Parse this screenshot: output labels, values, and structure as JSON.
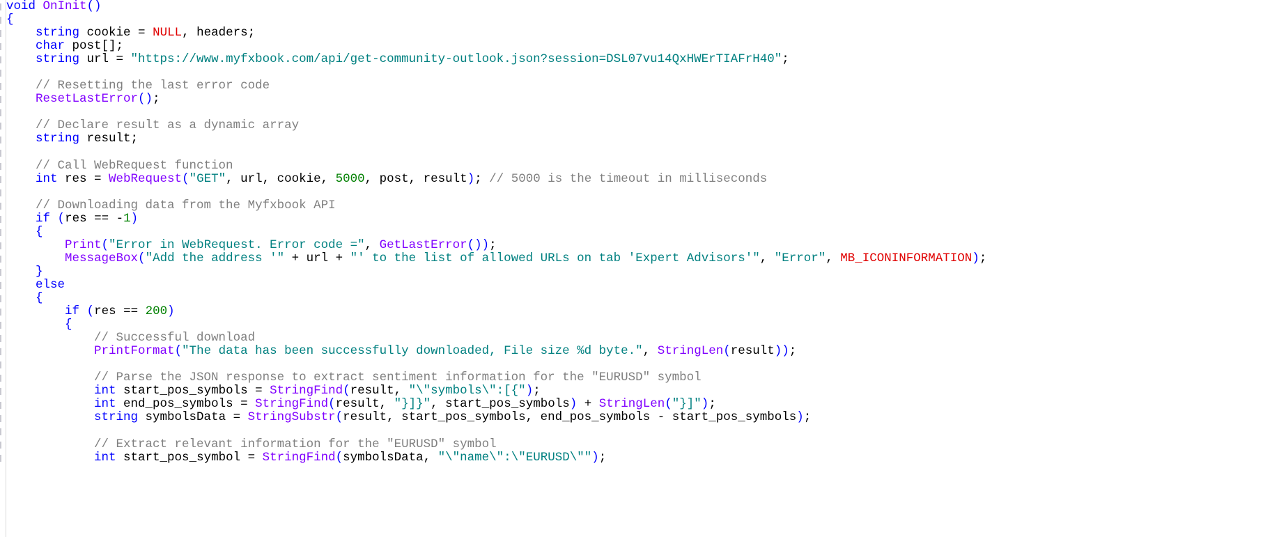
{
  "editor": {
    "colors": {
      "keyword": "#0000ff",
      "function": "#8000ff",
      "string": "#008080",
      "comment": "#808080",
      "number": "#008000",
      "constant": "#e00000",
      "plain": "#000000",
      "bracket": "#0000ff"
    },
    "lines": [
      [
        {
          "t": "kw",
          "v": "void"
        },
        {
          "t": "pl",
          "v": " "
        },
        {
          "t": "fn",
          "v": "OnInit"
        },
        {
          "t": "br",
          "v": "()"
        }
      ],
      [
        {
          "t": "br",
          "v": "{"
        }
      ],
      [
        {
          "t": "pl",
          "v": "    "
        },
        {
          "t": "kw",
          "v": "string"
        },
        {
          "t": "pl",
          "v": " cookie = "
        },
        {
          "t": "const",
          "v": "NULL"
        },
        {
          "t": "pl",
          "v": ", headers;"
        }
      ],
      [
        {
          "t": "pl",
          "v": "    "
        },
        {
          "t": "kw",
          "v": "char"
        },
        {
          "t": "pl",
          "v": " post[];"
        }
      ],
      [
        {
          "t": "pl",
          "v": "    "
        },
        {
          "t": "kw",
          "v": "string"
        },
        {
          "t": "pl",
          "v": " url = "
        },
        {
          "t": "str",
          "v": "\"https://www.myfxbook.com/api/get-community-outlook.json?session=DSL07vu14QxHWErTIAFrH40\""
        },
        {
          "t": "pl",
          "v": ";"
        }
      ],
      [],
      [
        {
          "t": "pl",
          "v": "    "
        },
        {
          "t": "cm",
          "v": "// Resetting the last error code"
        }
      ],
      [
        {
          "t": "pl",
          "v": "    "
        },
        {
          "t": "fn",
          "v": "ResetLastError"
        },
        {
          "t": "br",
          "v": "()"
        },
        {
          "t": "pl",
          "v": ";"
        }
      ],
      [],
      [
        {
          "t": "pl",
          "v": "    "
        },
        {
          "t": "cm",
          "v": "// Declare result as a dynamic array"
        }
      ],
      [
        {
          "t": "pl",
          "v": "    "
        },
        {
          "t": "kw",
          "v": "string"
        },
        {
          "t": "pl",
          "v": " result;"
        }
      ],
      [],
      [
        {
          "t": "pl",
          "v": "    "
        },
        {
          "t": "cm",
          "v": "// Call WebRequest function"
        }
      ],
      [
        {
          "t": "pl",
          "v": "    "
        },
        {
          "t": "kw",
          "v": "int"
        },
        {
          "t": "pl",
          "v": " res = "
        },
        {
          "t": "fn",
          "v": "WebRequest"
        },
        {
          "t": "br",
          "v": "("
        },
        {
          "t": "str",
          "v": "\"GET\""
        },
        {
          "t": "pl",
          "v": ", url, cookie, "
        },
        {
          "t": "num",
          "v": "5000"
        },
        {
          "t": "pl",
          "v": ", post, result"
        },
        {
          "t": "br",
          "v": ")"
        },
        {
          "t": "pl",
          "v": "; "
        },
        {
          "t": "cm",
          "v": "// 5000 is the timeout in milliseconds"
        }
      ],
      [],
      [
        {
          "t": "pl",
          "v": "    "
        },
        {
          "t": "cm",
          "v": "// Downloading data from the Myfxbook API"
        }
      ],
      [
        {
          "t": "pl",
          "v": "    "
        },
        {
          "t": "kw",
          "v": "if"
        },
        {
          "t": "pl",
          "v": " "
        },
        {
          "t": "br",
          "v": "("
        },
        {
          "t": "pl",
          "v": "res == -"
        },
        {
          "t": "num",
          "v": "1"
        },
        {
          "t": "br",
          "v": ")"
        }
      ],
      [
        {
          "t": "pl",
          "v": "    "
        },
        {
          "t": "br",
          "v": "{"
        }
      ],
      [
        {
          "t": "pl",
          "v": "        "
        },
        {
          "t": "fn",
          "v": "Print"
        },
        {
          "t": "br",
          "v": "("
        },
        {
          "t": "str",
          "v": "\"Error in WebRequest. Error code =\""
        },
        {
          "t": "pl",
          "v": ", "
        },
        {
          "t": "fn",
          "v": "GetLastError"
        },
        {
          "t": "br",
          "v": "())"
        },
        {
          "t": "pl",
          "v": ";"
        }
      ],
      [
        {
          "t": "pl",
          "v": "        "
        },
        {
          "t": "fn",
          "v": "MessageBox"
        },
        {
          "t": "br",
          "v": "("
        },
        {
          "t": "str",
          "v": "\"Add the address '\""
        },
        {
          "t": "pl",
          "v": " + url + "
        },
        {
          "t": "str",
          "v": "\"' to the list of allowed URLs on tab 'Expert Advisors'\""
        },
        {
          "t": "pl",
          "v": ", "
        },
        {
          "t": "str",
          "v": "\"Error\""
        },
        {
          "t": "pl",
          "v": ", "
        },
        {
          "t": "const",
          "v": "MB_ICONINFORMATION"
        },
        {
          "t": "br",
          "v": ")"
        },
        {
          "t": "pl",
          "v": ";"
        }
      ],
      [
        {
          "t": "pl",
          "v": "    "
        },
        {
          "t": "br",
          "v": "}"
        }
      ],
      [
        {
          "t": "pl",
          "v": "    "
        },
        {
          "t": "kw",
          "v": "else"
        }
      ],
      [
        {
          "t": "pl",
          "v": "    "
        },
        {
          "t": "br",
          "v": "{"
        }
      ],
      [
        {
          "t": "pl",
          "v": "        "
        },
        {
          "t": "kw",
          "v": "if"
        },
        {
          "t": "pl",
          "v": " "
        },
        {
          "t": "br",
          "v": "("
        },
        {
          "t": "pl",
          "v": "res == "
        },
        {
          "t": "num",
          "v": "200"
        },
        {
          "t": "br",
          "v": ")"
        }
      ],
      [
        {
          "t": "pl",
          "v": "        "
        },
        {
          "t": "br",
          "v": "{"
        }
      ],
      [
        {
          "t": "pl",
          "v": "            "
        },
        {
          "t": "cm",
          "v": "// Successful download"
        }
      ],
      [
        {
          "t": "pl",
          "v": "            "
        },
        {
          "t": "fn",
          "v": "PrintFormat"
        },
        {
          "t": "br",
          "v": "("
        },
        {
          "t": "str",
          "v": "\"The data has been successfully downloaded, File size %d byte.\""
        },
        {
          "t": "pl",
          "v": ", "
        },
        {
          "t": "fn",
          "v": "StringLen"
        },
        {
          "t": "br",
          "v": "("
        },
        {
          "t": "pl",
          "v": "result"
        },
        {
          "t": "br",
          "v": "))"
        },
        {
          "t": "pl",
          "v": ";"
        }
      ],
      [],
      [
        {
          "t": "pl",
          "v": "            "
        },
        {
          "t": "cm",
          "v": "// Parse the JSON response to extract sentiment information for the \"EURUSD\" symbol"
        }
      ],
      [
        {
          "t": "pl",
          "v": "            "
        },
        {
          "t": "kw",
          "v": "int"
        },
        {
          "t": "pl",
          "v": " start_pos_symbols = "
        },
        {
          "t": "fn",
          "v": "StringFind"
        },
        {
          "t": "br",
          "v": "("
        },
        {
          "t": "pl",
          "v": "result, "
        },
        {
          "t": "str",
          "v": "\"\\\"symbols\\\":[{\""
        },
        {
          "t": "br",
          "v": ")"
        },
        {
          "t": "pl",
          "v": ";"
        }
      ],
      [
        {
          "t": "pl",
          "v": "            "
        },
        {
          "t": "kw",
          "v": "int"
        },
        {
          "t": "pl",
          "v": " end_pos_symbols = "
        },
        {
          "t": "fn",
          "v": "StringFind"
        },
        {
          "t": "br",
          "v": "("
        },
        {
          "t": "pl",
          "v": "result, "
        },
        {
          "t": "str",
          "v": "\"}]}\""
        },
        {
          "t": "pl",
          "v": ", start_pos_symbols"
        },
        {
          "t": "br",
          "v": ")"
        },
        {
          "t": "pl",
          "v": " + "
        },
        {
          "t": "fn",
          "v": "StringLen"
        },
        {
          "t": "br",
          "v": "("
        },
        {
          "t": "str",
          "v": "\"}]\""
        },
        {
          "t": "br",
          "v": ")"
        },
        {
          "t": "pl",
          "v": ";"
        }
      ],
      [
        {
          "t": "pl",
          "v": "            "
        },
        {
          "t": "kw",
          "v": "string"
        },
        {
          "t": "pl",
          "v": " symbolsData = "
        },
        {
          "t": "fn",
          "v": "StringSubstr"
        },
        {
          "t": "br",
          "v": "("
        },
        {
          "t": "pl",
          "v": "result, start_pos_symbols, end_pos_symbols - start_pos_symbols"
        },
        {
          "t": "br",
          "v": ")"
        },
        {
          "t": "pl",
          "v": ";"
        }
      ],
      [],
      [
        {
          "t": "pl",
          "v": "            "
        },
        {
          "t": "cm",
          "v": "// Extract relevant information for the \"EURUSD\" symbol"
        }
      ],
      [
        {
          "t": "pl",
          "v": "            "
        },
        {
          "t": "kw",
          "v": "int"
        },
        {
          "t": "pl",
          "v": " start_pos_symbol = "
        },
        {
          "t": "fn",
          "v": "StringFind"
        },
        {
          "t": "br",
          "v": "("
        },
        {
          "t": "pl",
          "v": "symbolsData, "
        },
        {
          "t": "str",
          "v": "\"\\\"name\\\":\\\"EURUSD\\\"\""
        },
        {
          "t": "br",
          "v": ")"
        },
        {
          "t": "pl",
          "v": ";"
        }
      ]
    ]
  }
}
